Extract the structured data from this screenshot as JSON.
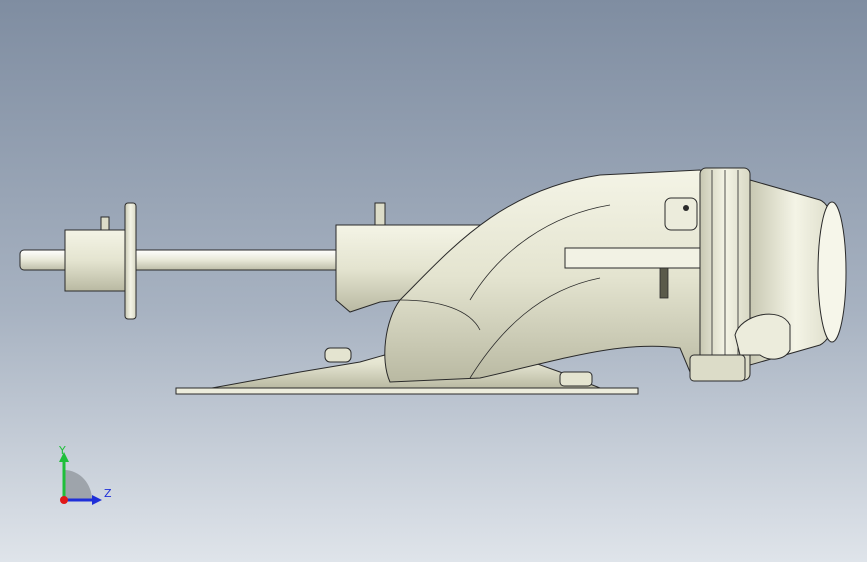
{
  "viewport": {
    "background_top": "#7f8da1",
    "background_bottom": "#dfe4ea"
  },
  "model": {
    "body_color": "#e9e9d7",
    "shade_color": "#c9c9b3",
    "edge_color": "#2a2a2a"
  },
  "triad": {
    "y_label": "Y",
    "z_label": "Z",
    "y_color": "#1fbf3a",
    "z_color": "#1f2fd8",
    "x_color": "#e01818"
  }
}
